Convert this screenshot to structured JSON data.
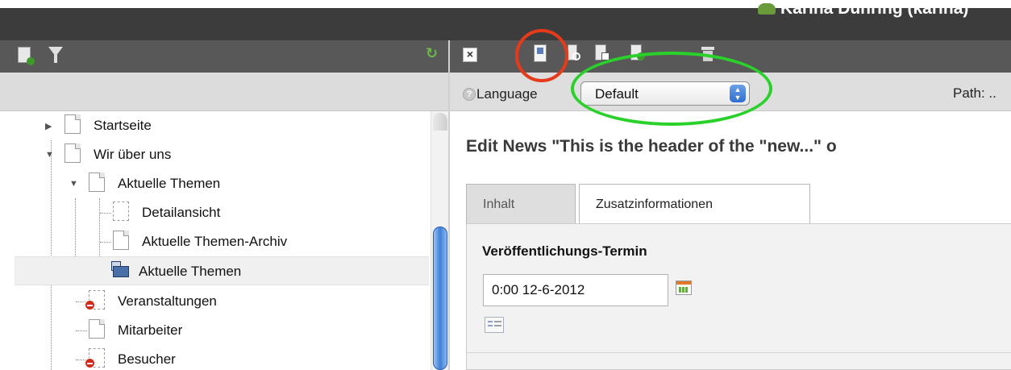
{
  "user": {
    "name": "Karina Dühring (karina)"
  },
  "toolbar": {
    "icons": [
      "new-record-icon",
      "filter-icon",
      "refresh-icon",
      "close-document-icon",
      "save-icon",
      "save-and-view-icon",
      "save-and-close-icon",
      "save-and-new-icon",
      "delete-icon"
    ]
  },
  "language": {
    "label": "Language",
    "selected": "Default"
  },
  "path": {
    "label": "Path: .."
  },
  "tree": {
    "items": [
      {
        "label": "Startseite"
      },
      {
        "label": "Wir über uns"
      },
      {
        "label": "Aktuelle Themen"
      },
      {
        "label": "Detailansicht"
      },
      {
        "label": "Aktuelle Themen-Archiv"
      },
      {
        "label": "Aktuelle Themen"
      },
      {
        "label": "Veranstaltungen"
      },
      {
        "label": "Mitarbeiter"
      },
      {
        "label": "Besucher"
      }
    ]
  },
  "editor": {
    "title": "Edit News \"This is the header of the \"new...\" o",
    "tabs": [
      {
        "label": "Inhalt"
      },
      {
        "label": "Zusatzinformationen"
      }
    ],
    "field_label": "Veröffentlichungs-Termin",
    "date_value": "0:00 12-6-2012"
  },
  "colors": {
    "annotation_red": "#e63a1a",
    "annotation_green": "#2ad12a",
    "toolbar_bg": "#585858",
    "scroll_thumb": "#3e7fd8"
  }
}
